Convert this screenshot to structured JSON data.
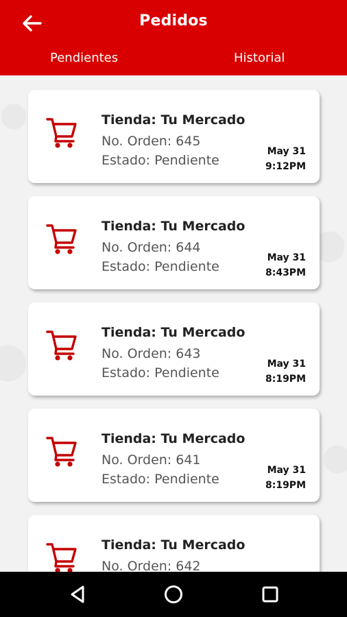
{
  "header": {
    "title": "Pedidos",
    "back_icon": "arrow-left-icon",
    "tabs": [
      {
        "label": "Pendientes"
      },
      {
        "label": "Historial"
      }
    ]
  },
  "colors": {
    "header_bg": "#d80000",
    "cart_icon": "#c40000"
  },
  "orders": [
    {
      "store": "Tienda: Tu Mercado",
      "order": "No. Orden: 645",
      "status": "Estado: Pendiente",
      "date": "May 31",
      "time": "9:12PM"
    },
    {
      "store": "Tienda: Tu Mercado",
      "order": "No. Orden: 644",
      "status": "Estado: Pendiente",
      "date": "May 31",
      "time": "8:43PM"
    },
    {
      "store": "Tienda: Tu Mercado",
      "order": "No. Orden: 643",
      "status": "Estado: Pendiente",
      "date": "May 31",
      "time": "8:19PM"
    },
    {
      "store": "Tienda: Tu Mercado",
      "order": "No. Orden: 641",
      "status": "Estado: Pendiente",
      "date": "May 31",
      "time": "8:19PM"
    },
    {
      "store": "Tienda: Tu Mercado",
      "order": "No. Orden: 642",
      "status": "",
      "date": "",
      "time": ""
    }
  ],
  "navbar": {
    "icons": [
      "back-triangle-icon",
      "home-circle-icon",
      "recents-square-icon"
    ]
  }
}
